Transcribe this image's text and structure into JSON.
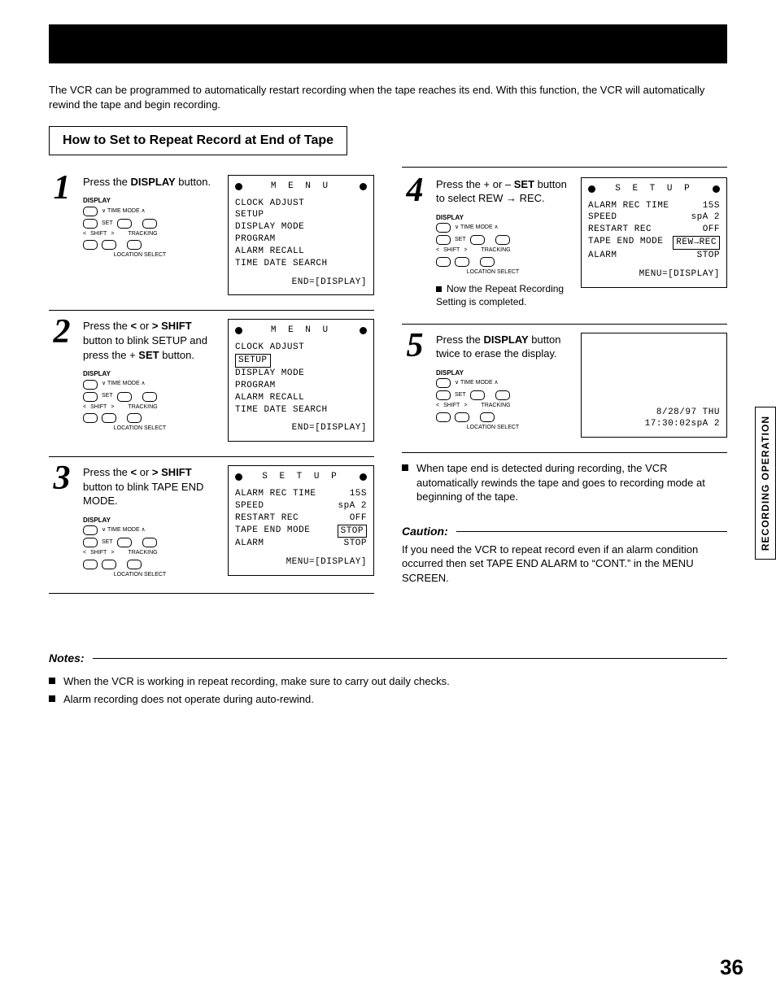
{
  "intro": "The VCR can be programmed to automatically restart recording when the tape reaches its end. With this function, the VCR will automatically rewind the tape and begin recording.",
  "title": "How to Set to Repeat Record at End of Tape",
  "steps": {
    "s1": {
      "num": "1",
      "text_a": "Press the ",
      "key1": "DISPLAY",
      "text_b": " button."
    },
    "s2": {
      "num": "2",
      "text_a": "Press the ",
      "key1": "<",
      "text_b": " or ",
      "key2": ">",
      "text_c": " ",
      "key3": "SHIFT",
      "text_d": " button to blink SETUP and press the + ",
      "key4": "SET",
      "text_e": " button."
    },
    "s3": {
      "num": "3",
      "text_a": "Press the ",
      "key1": "<",
      "text_b": " or ",
      "key2": ">",
      "text_c": " ",
      "key3": "SHIFT",
      "text_d": " button to blink TAPE END MODE."
    },
    "s4": {
      "num": "4",
      "text_a": "Press the + or – ",
      "key1": "SET",
      "text_b": " button to select REW → REC.",
      "below": "Now the Repeat Recording Setting is completed."
    },
    "s5": {
      "num": "5",
      "text_a": "Press the ",
      "key1": "DISPLAY",
      "text_b": " button twice to erase the display."
    }
  },
  "screens": {
    "menu1": {
      "title": "M E N U",
      "lines": [
        "CLOCK ADJUST",
        "SETUP",
        "DISPLAY MODE",
        "PROGRAM",
        "ALARM RECALL",
        "TIME DATE SEARCH"
      ],
      "foot": "END=[DISPLAY]"
    },
    "menu2": {
      "title": "M E N U",
      "lines": [
        "CLOCK ADJUST",
        "SETUP",
        "DISPLAY MODE",
        "PROGRAM",
        "ALARM RECALL",
        "TIME DATE SEARCH"
      ],
      "sel": "SETUP",
      "foot": "END=[DISPLAY]"
    },
    "setup3": {
      "title": "S E T U P",
      "rows": [
        [
          "ALARM REC TIME",
          "15S"
        ],
        [
          "SPEED",
          "spA 2"
        ],
        [
          "RESTART REC",
          "OFF"
        ],
        [
          "TAPE END MODE",
          "STOP"
        ],
        [
          "ALARM",
          "STOP"
        ]
      ],
      "selrow": 3,
      "foot": "MENU=[DISPLAY]"
    },
    "setup4": {
      "title": "S E T U P",
      "rows": [
        [
          "ALARM REC TIME",
          "15S"
        ],
        [
          "SPEED",
          "spA 2"
        ],
        [
          "RESTART REC",
          "OFF"
        ],
        [
          "TAPE END MODE",
          "REW→REC"
        ],
        [
          "ALARM",
          "STOP"
        ]
      ],
      "selrow": 3,
      "foot": "MENU=[DISPLAY]"
    },
    "time5": {
      "l1": "8/28/97 THU",
      "l2": "17:30:02spA 2"
    }
  },
  "ctrls": {
    "display": "DISPLAY",
    "timemode": "∨ TIME MODE ∧",
    "set": "SET",
    "shift": "SHIFT",
    "tracking": "TRACKING",
    "loc": "LOCATION SELECT"
  },
  "right_bullet": "When tape end is detected during recording, the VCR automatically rewinds the tape and goes to recording mode at beginning of the tape.",
  "caution": {
    "heading": "Caution:",
    "text": "If you need the VCR to repeat record even if an alarm condition occurred then set TAPE END ALARM to “CONT.” in the MENU SCREEN."
  },
  "notes": {
    "heading": "Notes:",
    "b1": "When the VCR is working in repeat recording, make sure to carry out daily checks.",
    "b2": "Alarm recording does not operate during auto-rewind."
  },
  "sidetab": "RECORDING OPERATION",
  "pagenum": "36"
}
